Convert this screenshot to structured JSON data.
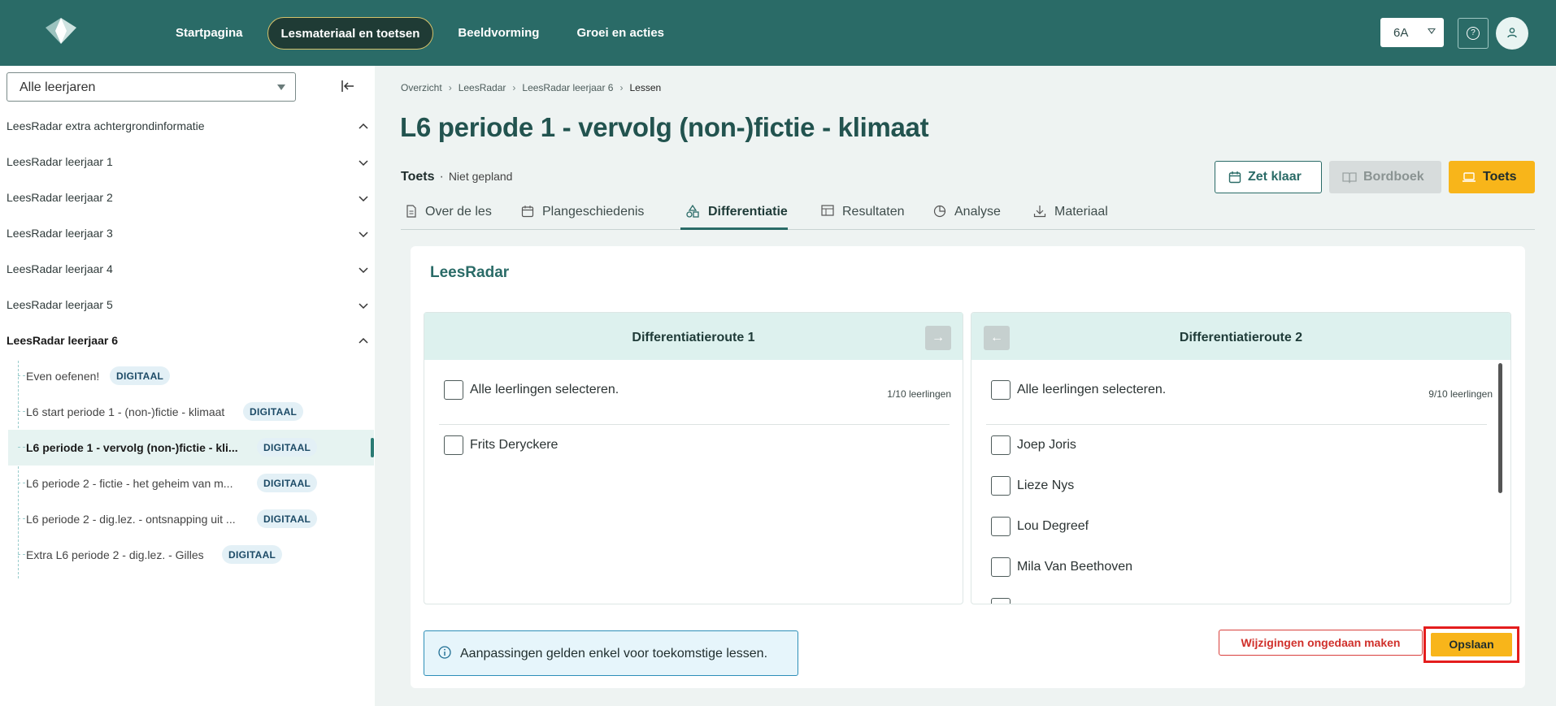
{
  "nav": {
    "items": [
      "Startpagina",
      "Lesmateriaal en toetsen",
      "Beeldvorming",
      "Groei en acties"
    ],
    "active_index": 1,
    "class_select": "6A",
    "help_label": "?",
    "avatar_icon": "user-icon"
  },
  "sidebar": {
    "year_select": "Alle leerjaren",
    "groups": [
      {
        "label": "LeesRadar extra achtergrondinformatie",
        "expanded": true
      },
      {
        "label": "LeesRadar leerjaar 1",
        "expanded": false
      },
      {
        "label": "LeesRadar leerjaar 2",
        "expanded": false
      },
      {
        "label": "LeesRadar leerjaar 3",
        "expanded": false
      },
      {
        "label": "LeesRadar leerjaar 4",
        "expanded": false
      },
      {
        "label": "LeesRadar leerjaar 5",
        "expanded": false
      },
      {
        "label": "LeesRadar leerjaar 6",
        "expanded": true
      }
    ],
    "items": [
      {
        "label": "Even oefenen!",
        "badge": "DIGITAAL"
      },
      {
        "label": "L6 start periode 1 - (non-)fictie - klimaat",
        "badge": "DIGITAAL"
      },
      {
        "label": "L6 periode 1 - vervolg (non-)fictie - kli...",
        "badge": "DIGITAAL",
        "active": true
      },
      {
        "label": "L6 periode 2 - fictie - het geheim van m...",
        "badge": "DIGITAAL"
      },
      {
        "label": "L6 periode 2 - dig.lez. - ontsnapping uit ...",
        "badge": "DIGITAAL"
      },
      {
        "label": "Extra L6 periode 2 - dig.lez. - Gilles",
        "badge": "DIGITAAL"
      }
    ]
  },
  "breadcrumb": [
    "Overzicht",
    "LeesRadar",
    "LeesRadar leerjaar 6",
    "Lessen"
  ],
  "page": {
    "title": "L6 periode 1 - vervolg (non-)fictie - klimaat",
    "type": "Toets",
    "status": "Niet gepland"
  },
  "actions": {
    "zet_klaar": "Zet klaar",
    "bordboek": "Bordboek",
    "toets": "Toets"
  },
  "tabs": [
    {
      "label": "Over de les",
      "icon": "document-icon"
    },
    {
      "label": "Plangeschiedenis",
      "icon": "calendar-icon"
    },
    {
      "label": "Differentiatie",
      "icon": "shapes-icon",
      "active": true
    },
    {
      "label": "Resultaten",
      "icon": "table-icon"
    },
    {
      "label": "Analyse",
      "icon": "pie-chart-icon"
    },
    {
      "label": "Materiaal",
      "icon": "download-icon"
    }
  ],
  "card": {
    "title": "LeesRadar",
    "route1": {
      "title": "Differentiatieroute 1",
      "select_all": "Alle leerlingen selecteren.",
      "count": "1/10 leerlingen",
      "students": [
        "Frits Deryckere"
      ]
    },
    "route2": {
      "title": "Differentiatieroute 2",
      "select_all": "Alle leerlingen selecteren.",
      "count": "9/10 leerlingen",
      "students": [
        "Joep Joris",
        "Lieze Nys",
        "Lou Degreef",
        "Mila Van Beethoven"
      ]
    },
    "info": "Aanpassingen gelden enkel voor toekomstige lessen."
  },
  "footer": {
    "undo": "Wijzigingen ongedaan maken",
    "save": "Opslaan"
  },
  "colors": {
    "brand": "#2a6b67",
    "accent": "#f8b51a",
    "danger": "#d0302b"
  }
}
